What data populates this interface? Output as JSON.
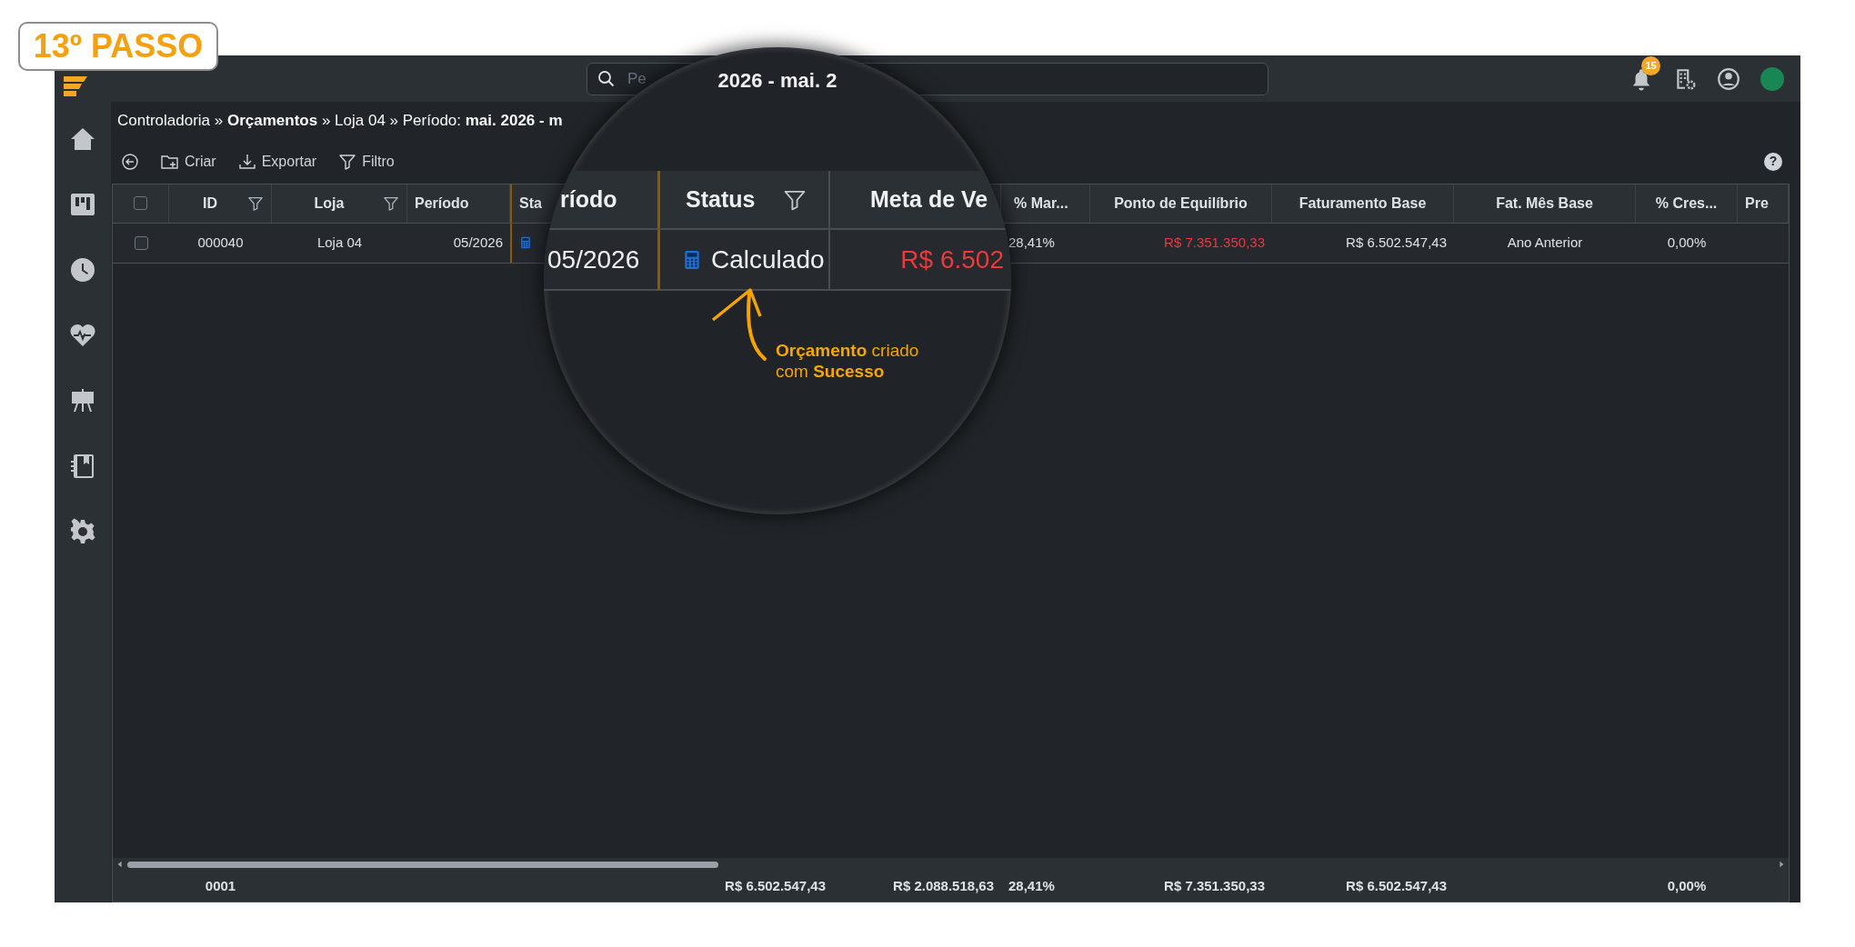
{
  "step_badge": "13º PASSO",
  "topbar": {
    "search": {
      "placeholder": "Pe"
    },
    "notification_count": "15"
  },
  "breadcrumb": "Controladoria » **Orçamentos** » Loja 04 » Período: **mai. 2026 - m**",
  "toolbar": [
    "Criar",
    "Exportar",
    "Filtro"
  ],
  "help_label": "?",
  "table": {
    "select_all": {
      "checked": false
    },
    "columns": [
      {
        "label": "ID",
        "filterable": true
      },
      {
        "label": "Loja",
        "filterable": true
      },
      {
        "label": "Período",
        "filterable": false
      },
      {
        "label": "Sta",
        "filterable": false
      },
      {
        "label": "% Mar...",
        "filterable": false
      },
      {
        "label": "Ponto de Equilíbrio",
        "filterable": false
      },
      {
        "label": "Faturamento Base",
        "filterable": false
      },
      {
        "label": "Fat. Mês Base",
        "filterable": false
      },
      {
        "label": "% Cres...",
        "filterable": false
      },
      {
        "label": "Pre",
        "filterable": false
      }
    ],
    "rows": [
      {
        "selected": false,
        "cells": [
          {
            "text": "000040"
          },
          {
            "text": "Loja 04"
          },
          {
            "text": "05/2026"
          },
          {
            "text": ""
          },
          {
            "text": "28,41%"
          },
          {
            "text": "R$ 7.351.350,33",
            "negative": true
          },
          {
            "text": "R$ 6.502.547,43"
          },
          {
            "text": "Ano Anterior"
          },
          {
            "text": "0,00%"
          },
          {
            "text": ""
          }
        ]
      }
    ],
    "totals": [
      "0001",
      "R$ 6.502.547,43",
      "R$ 2.088.518,63",
      "28,41%",
      "R$ 7.351.350,33",
      "R$ 6.502.547,43",
      "0,00%"
    ]
  },
  "magnifier": {
    "breadcrumb_fragment": "2026 - mai. 2",
    "columns": [
      {
        "label": "ríodo",
        "filterable": false
      },
      {
        "label": "Status",
        "filterable": true
      },
      {
        "label": "Meta de Ve",
        "filterable": false
      }
    ],
    "cells": [
      {
        "text": "05/2026",
        "negative": false
      },
      {
        "text": "Calculado",
        "kind": "status",
        "negative": false
      },
      {
        "text": "R$ 6.502",
        "negative": true
      }
    ],
    "callout": "**Orçamento** criado\ncom **Sucesso**"
  }
}
